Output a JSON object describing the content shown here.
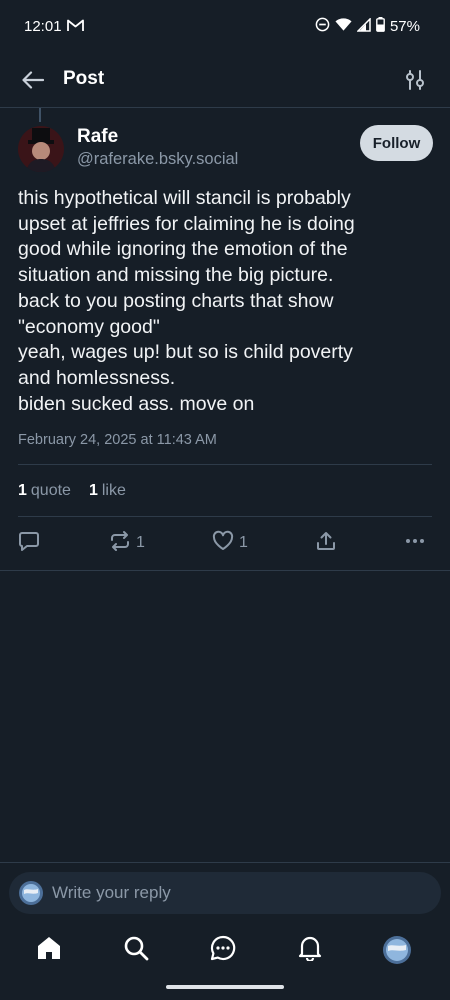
{
  "status_bar": {
    "time": "12:01",
    "battery": "57%",
    "icons": [
      "gmail-icon",
      "do-not-disturb-icon",
      "wifi-icon",
      "signal-icon",
      "battery-icon"
    ]
  },
  "header": {
    "title": "Post",
    "back_icon": "arrow-left-icon",
    "filter_icon": "sliders-icon"
  },
  "post": {
    "author": {
      "display_name": "Rafe",
      "handle": "@raferake.bsky.social"
    },
    "follow_label": "Follow",
    "text": "this hypothetical will stancil is probably\nupset at jeffries for claiming he is doing\ngood while ignoring the emotion of the\nsituation and missing the big picture.\nback to you posting charts that show\n\"economy good\"\nyeah, wages up! but so is child poverty\nand homlessness.\nbiden sucked ass. move on",
    "timestamp": "February 24, 2025 at 11:43 AM",
    "stats": {
      "quotes_count": "1",
      "quotes_label": "quote",
      "likes_count": "1",
      "likes_label": "like"
    },
    "actions": {
      "reply_count": "",
      "repost_count": "1",
      "like_count": "1"
    }
  },
  "reply_bar": {
    "placeholder": "Write your reply"
  },
  "bottom_nav": {
    "items": [
      "home-icon",
      "search-icon",
      "chat-icon",
      "bell-icon",
      "profile-avatar"
    ]
  },
  "colors": {
    "background": "#161e27",
    "text_primary": "#f1f3f5",
    "text_secondary": "#8b98a7",
    "divider": "#2e3b49",
    "follow_button_bg": "#d4dbe2"
  }
}
